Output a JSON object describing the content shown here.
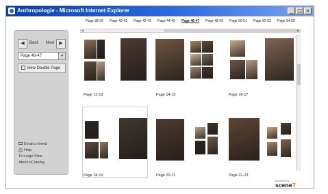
{
  "window": {
    "title": "Anthropologie - Microsoft Internet Explorer",
    "controls": {
      "minimize": "_",
      "maximize": "□",
      "close": "×"
    }
  },
  "sidebar": {
    "back_label": "Back",
    "next_label": "Next",
    "back_arrow": "◀",
    "next_arrow": "▶",
    "page_select": {
      "value": "Page 46-47",
      "arrow": "▼"
    },
    "double_page_label": "View Double Page",
    "links": {
      "email": "Email a friend",
      "help": "Help",
      "help_glyph": "?",
      "large_view": "To Large View",
      "about": "About eCatalog"
    }
  },
  "page_tabs": [
    {
      "label": "Page 38-39",
      "active": false
    },
    {
      "label": "Page 40-41",
      "active": false
    },
    {
      "label": "Page 42-43",
      "active": false
    },
    {
      "label": "Page 44-45",
      "active": false
    },
    {
      "label": "Page 46-47",
      "active": true
    },
    {
      "label": "Page 48-49",
      "active": false
    },
    {
      "label": "Page 50-51",
      "active": false
    },
    {
      "label": "Page 52-53",
      "active": false
    },
    {
      "label": "Page 54-55",
      "active": false
    }
  ],
  "spreads": [
    {
      "caption": "Page 12-13",
      "selected": false
    },
    {
      "caption": "Page 14-15",
      "selected": false
    },
    {
      "caption": "Page 16-17",
      "selected": false
    },
    {
      "caption": "Page 18-19",
      "selected": true
    },
    {
      "caption": "Page 20-21",
      "selected": false
    },
    {
      "caption": "Page 22-23",
      "selected": false
    }
  ],
  "scroll_arrows": {
    "left": "◀",
    "right": "▶"
  },
  "powered_by": {
    "small": "powered by",
    "logo": "scene",
    "logo_suffix": "7"
  },
  "colors": {
    "titlebar_start": "#0a3fa8",
    "titlebar_end": "#7aa4ee",
    "sidebar_bg": "#d2d2d2",
    "logo_accent": "#e08a10"
  }
}
